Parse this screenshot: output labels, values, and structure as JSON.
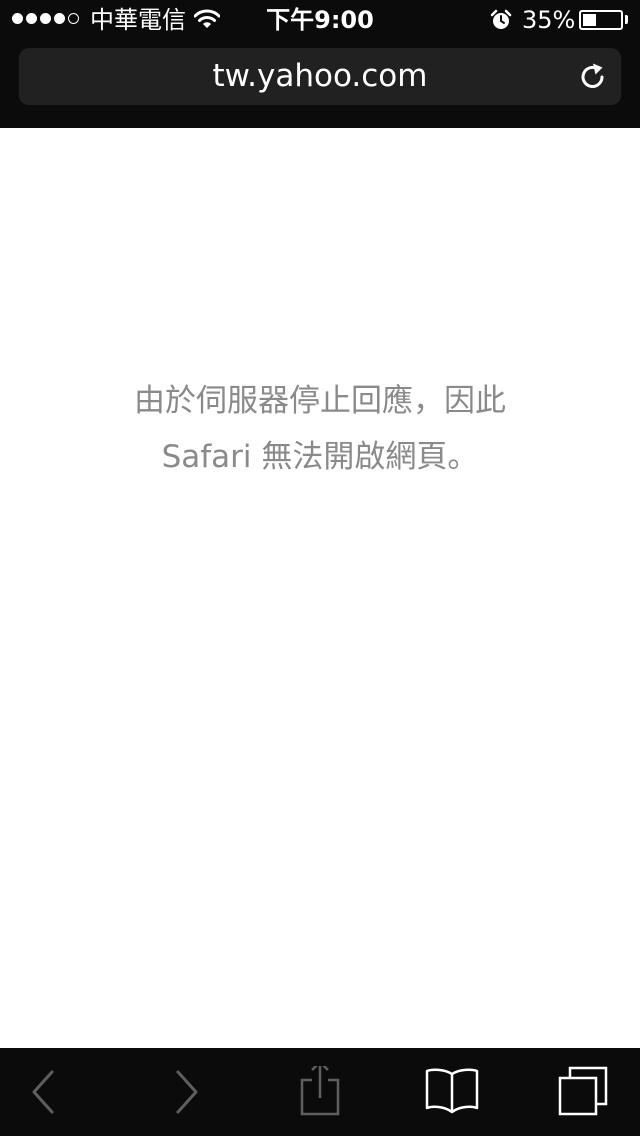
{
  "status_bar": {
    "carrier": "中華電信",
    "time": "下午9:00",
    "battery_percent": "35%",
    "battery_level": 0.35,
    "signal_bars_filled": 4,
    "signal_bars_total": 5
  },
  "address_bar": {
    "url": "tw.yahoo.com",
    "reload_icon": "reload-icon"
  },
  "error": {
    "line1": "由於伺服器停止回應，因此",
    "line2": "Safari 無法開啟網頁。"
  },
  "toolbar": {
    "items": [
      "back-icon",
      "forward-icon",
      "share-icon",
      "bookmarks-icon",
      "tabs-icon"
    ]
  },
  "colors": {
    "chrome_bg": "#0b0b0b",
    "address_bg": "#212121",
    "error_text": "#8a8a8a",
    "disabled_icon": "#5f5f5f"
  }
}
